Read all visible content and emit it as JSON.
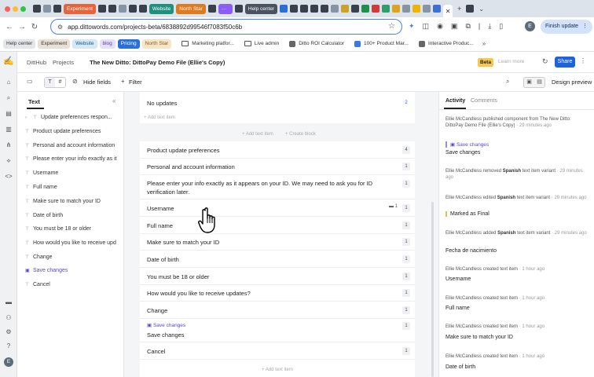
{
  "browser": {
    "tab_chips": [
      {
        "label": "Experiment",
        "color": "#e8623a"
      },
      {
        "label": "Website",
        "color": "#1f8f7e"
      },
      {
        "label": "North Star",
        "color": "#e07a1f"
      },
      {
        "label": "Help center",
        "color": "#4a5360"
      }
    ],
    "url": "app.dittowords.com/projects-beta/6838892d99546f7083f50c6b",
    "finish_update": "Finish update",
    "avatar_letter": "E",
    "bookmarks": [
      {
        "label": "Help center",
        "bg": "#e4e6ea",
        "fg": "#333"
      },
      {
        "label": "Experiment",
        "bg": "#e8e0d6",
        "fg": "#333"
      },
      {
        "label": "Website",
        "bg": "#d4e8f7",
        "fg": "#1c5a8a"
      },
      {
        "label": "blog",
        "bg": "#e6e0f6",
        "fg": "#5a3fa8"
      },
      {
        "label": "Pricing",
        "bg": "#2b6fd8",
        "fg": "#fff"
      },
      {
        "label": "North Star",
        "bg": "#f6e6c9",
        "fg": "#8a5a12"
      }
    ],
    "bookmark_links": [
      "Marketing platfor...",
      "Live admin",
      "Ditto ROI Calculator",
      "100+ Product Mar...",
      "Interactive Produc..."
    ]
  },
  "app": {
    "breadcrumb": [
      "DittHub",
      "Projects"
    ],
    "project_title": "The New Ditto: DittoPay Demo File (Ellie's Copy)",
    "beta": "Beta",
    "learn_more": "Learn more",
    "share": "Share",
    "toolbar": {
      "hide_fields": "Hide fields",
      "filter": "Filter",
      "design_preview": "Design preview"
    },
    "text_panel": {
      "heading": "Text",
      "group": "Update preferences respon...",
      "items": [
        "Product update preferences",
        "Personal and account information",
        "Please enter your info exactly as it",
        "Username",
        "Full name",
        "Make sure to match your ID",
        "Date of birth",
        "You must be 18 or older",
        "How would you like to receive upd",
        "Change"
      ],
      "component": "Save changes",
      "last_item": "Cancel"
    },
    "editor": {
      "no_updates": "No updates",
      "no_updates_count": "2",
      "add_text_item_top": "+ Add text item",
      "add_text_item": "+ Add text item",
      "create_block": "+ Create block",
      "rows": [
        {
          "text": "Product update preferences",
          "count": "4"
        },
        {
          "text": "Personal and account information",
          "count": "1"
        },
        {
          "text": "Please enter your info exactly as it appears on your ID. We may need to ask you for ID verification later.",
          "count": "1"
        },
        {
          "text": "Username",
          "count": "1",
          "comments": "1"
        },
        {
          "text": "Full name",
          "count": "1"
        },
        {
          "text": "Make sure to match your ID",
          "count": "1"
        },
        {
          "text": "Date of birth",
          "count": "1"
        },
        {
          "text": "You must be 18 or older",
          "count": "1"
        },
        {
          "text": "How would you like to receive updates?",
          "count": "1"
        },
        {
          "text": "Change",
          "count": "1"
        }
      ],
      "component_label": "Save changes",
      "component_text": "Save changes",
      "component_count": "1",
      "cancel": "Cancel",
      "cancel_count": "1",
      "add_text_item_bottom": "+ Add text item"
    },
    "activity": {
      "tab_activity": "Activity",
      "tab_comments": "Comments",
      "entries": [
        {
          "who": "Ellie McCandless",
          "action": "published component from The New Ditto: DittoPay Demo File (Ellie's Copy)",
          "time": "· 29 minutes ago",
          "sub": "Save changes",
          "value": "Save changes"
        },
        {
          "who": "Ellie McCandless",
          "action": "removed",
          "bold": "Spanish",
          "action2": "text item variant",
          "time": "· 29 minutes ago"
        },
        {
          "who": "Ellie McCandless",
          "action": "edited",
          "bold": "Spanish",
          "action2": "text item variant",
          "time": "· 29 minutes ago",
          "value": "Marked as Final"
        },
        {
          "who": "Ellie McCandless",
          "action": "added",
          "bold": "Spanish",
          "action2": "text item variant",
          "time": "· 29 minutes ago",
          "value": "Fecha de nacimiento"
        },
        {
          "who": "Ellie McCandless",
          "action": "created text item",
          "time": "· 1 hour ago",
          "value": "Username"
        },
        {
          "who": "Ellie McCandless",
          "action": "created text item",
          "time": "· 1 hour ago",
          "value": "Full name"
        },
        {
          "who": "Ellie McCandless",
          "action": "created text item",
          "time": "· 1 hour ago",
          "value": "Make sure to match your ID"
        },
        {
          "who": "Ellie McCandless",
          "action": "created text item",
          "time": "· 1 hour ago",
          "value": "Date of birth"
        }
      ]
    }
  }
}
